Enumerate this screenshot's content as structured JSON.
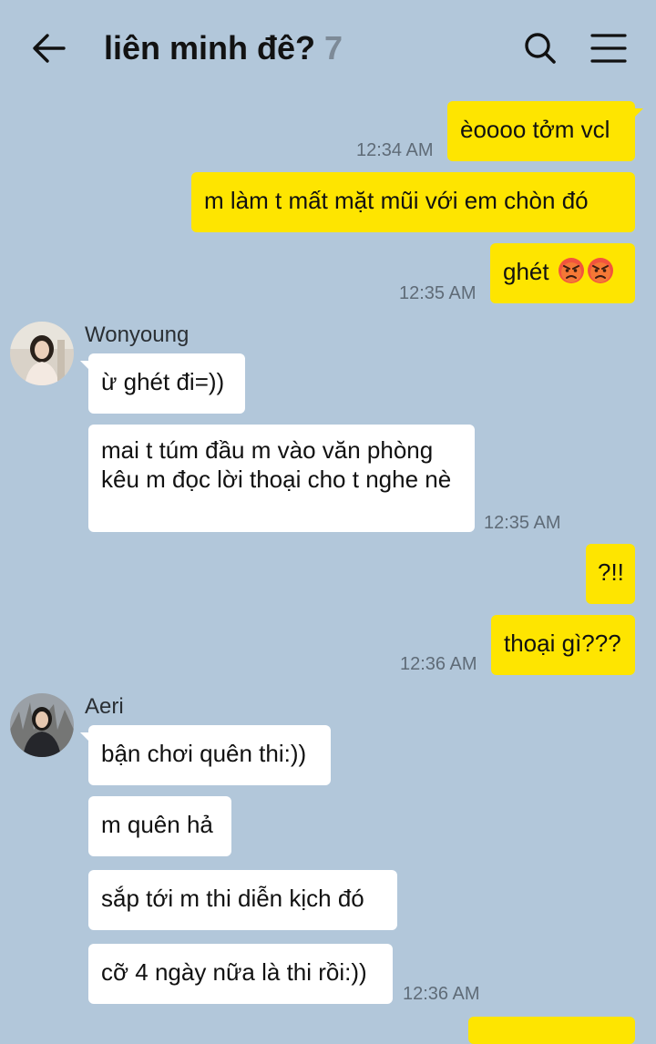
{
  "header": {
    "title": "liên minh đê?",
    "member_count": "7"
  },
  "messages": [
    {
      "text": "èoooo tởm vcl",
      "time": "12:34 AM"
    },
    {
      "text": "m làm t mất mặt mũi với em chòn đó"
    },
    {
      "text": "ghét",
      "emoji": [
        "angry-face-icon",
        "angry-face-icon"
      ],
      "time": "12:35 AM"
    },
    {
      "sender": "Wonyoung",
      "text": "ừ ghét đi=))"
    },
    {
      "text": "mai t túm đầu m vào văn phòng kêu m đọc lời thoại cho t nghe nè",
      "time": "12:35 AM"
    },
    {
      "text": "?!!"
    },
    {
      "text": "thoại gì???",
      "time": "12:36 AM"
    },
    {
      "sender": "Aeri",
      "text": "bận chơi quên thi:))"
    },
    {
      "text": "m quên hả"
    },
    {
      "text": "sắp tới m thi diễn kịch đó"
    },
    {
      "text": "cỡ 4 ngày nữa là thi rồi:))",
      "time": "12:36 AM"
    }
  ],
  "colors": {
    "background": "#b2c7da",
    "outgoing_bubble": "#fee500",
    "incoming_bubble": "#ffffff",
    "timestamp": "#5f6b77"
  }
}
